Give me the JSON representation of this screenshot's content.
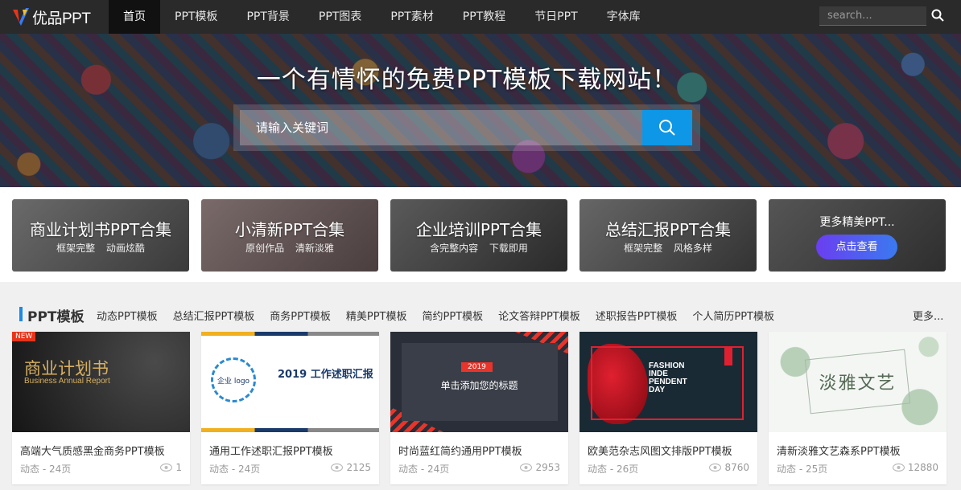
{
  "header": {
    "logo_text": "优品PPT",
    "nav": [
      "首页",
      "PPT模板",
      "PPT背景",
      "PPT图表",
      "PPT素材",
      "PPT教程",
      "节日PPT",
      "字体库"
    ],
    "search_placeholder": "search..."
  },
  "hero": {
    "title": "一个有情怀的免费PPT模板下载网站！",
    "search_placeholder": "请输入关键词"
  },
  "collections": [
    {
      "title": "商业计划书PPT合集",
      "subtitle": "框架完整 动画炫酷"
    },
    {
      "title": "小清新PPT合集",
      "subtitle": "原创作品 清新淡雅"
    },
    {
      "title": "企业培训PPT合集",
      "subtitle": "含完整内容 下载即用"
    },
    {
      "title": "总结汇报PPT合集",
      "subtitle": "框架完整 风格多样"
    }
  ],
  "more_collection": {
    "title": "更多精美PPT...",
    "button": "点击查看"
  },
  "section": {
    "title": "PPT模板",
    "tags": [
      "动态PPT模板",
      "总结汇报PPT模板",
      "商务PPT模板",
      "精美PPT模板",
      "简约PPT模板",
      "论文答辩PPT模板",
      "述职报告PPT模板",
      "个人简历PPT模板"
    ],
    "more": "更多..."
  },
  "cards": [
    {
      "title": "高端大气质感黑金商务PPT模板",
      "meta": "动态 - 24页",
      "views": "1",
      "badge": "NEW",
      "thumb_title": "商业计划书",
      "thumb_sub": "Business Annual Report"
    },
    {
      "title": "通用工作述职汇报PPT模板",
      "meta": "动态 - 24页",
      "views": "2125",
      "thumb_title": "2019 工作述职汇报",
      "thumb_logo": "企业 logo"
    },
    {
      "title": "时尚蓝红简约通用PPT模板",
      "meta": "动态 - 24页",
      "views": "2953",
      "thumb_year": "2019",
      "thumb_title": "单击添加您的标题"
    },
    {
      "title": "欧美范杂志风图文排版PPT模板",
      "meta": "动态 - 26页",
      "views": "8760",
      "thumb_title": "FASHION INDE PENDENT DAY"
    },
    {
      "title": "清新淡雅文艺森系PPT模板",
      "meta": "动态 - 25页",
      "views": "12880",
      "thumb_title": "淡雅文艺"
    }
  ],
  "colors": {
    "accent": "#0e97e6",
    "topbar": "#2a2a2a",
    "badge": "#e8341a"
  }
}
